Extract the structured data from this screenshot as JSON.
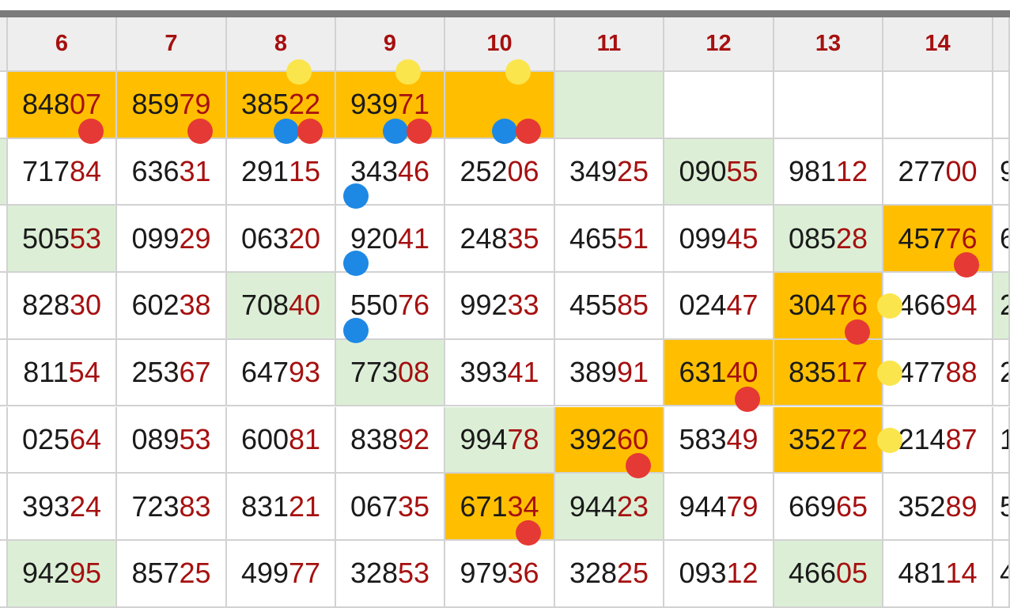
{
  "colors": {
    "header_bg": "#eeeeee",
    "header_text": "#a61010",
    "number_prefix": "#1a1a1a",
    "number_suffix": "#a61010",
    "green": "#dcefd6",
    "orange": "#ffbf00",
    "red_dot": "#e53935",
    "blue_dot": "#1e88e5",
    "yellow_dot": "#fbe54d"
  },
  "headers": [
    "",
    "6",
    "7",
    "8",
    "9",
    "10",
    "11",
    "12",
    "13",
    "14",
    ""
  ],
  "rows": [
    [
      {
        "v": "",
        "bg": "w"
      },
      {
        "v": "84807",
        "bg": "o"
      },
      {
        "v": "85979",
        "bg": "o"
      },
      {
        "v": "38522",
        "bg": "o"
      },
      {
        "v": "93971",
        "bg": "o"
      },
      {
        "v": "",
        "bg": "o"
      },
      {
        "v": "",
        "bg": "g"
      },
      {
        "v": "",
        "bg": "w"
      },
      {
        "v": "",
        "bg": "w"
      },
      {
        "v": "",
        "bg": "w"
      },
      {
        "v": "",
        "bg": "w"
      }
    ],
    [
      {
        "v": "",
        "bg": "g"
      },
      {
        "v": "71784",
        "bg": "w"
      },
      {
        "v": "63631",
        "bg": "w"
      },
      {
        "v": "29115",
        "bg": "w"
      },
      {
        "v": "34346",
        "bg": "w"
      },
      {
        "v": "25206",
        "bg": "w"
      },
      {
        "v": "34925",
        "bg": "w"
      },
      {
        "v": "09055",
        "bg": "g"
      },
      {
        "v": "98112",
        "bg": "w"
      },
      {
        "v": "27700",
        "bg": "w"
      },
      {
        "v": "9",
        "bg": "w"
      }
    ],
    [
      {
        "v": "",
        "bg": "w"
      },
      {
        "v": "50553",
        "bg": "g"
      },
      {
        "v": "09929",
        "bg": "w"
      },
      {
        "v": "06320",
        "bg": "w"
      },
      {
        "v": "92041",
        "bg": "w"
      },
      {
        "v": "24835",
        "bg": "w"
      },
      {
        "v": "46551",
        "bg": "w"
      },
      {
        "v": "09945",
        "bg": "w"
      },
      {
        "v": "08528",
        "bg": "g"
      },
      {
        "v": "45776",
        "bg": "o"
      },
      {
        "v": "6",
        "bg": "w"
      }
    ],
    [
      {
        "v": "",
        "bg": "w"
      },
      {
        "v": "82830",
        "bg": "w"
      },
      {
        "v": "60238",
        "bg": "w"
      },
      {
        "v": "70840",
        "bg": "g"
      },
      {
        "v": "55076",
        "bg": "w"
      },
      {
        "v": "99233",
        "bg": "w"
      },
      {
        "v": "45585",
        "bg": "w"
      },
      {
        "v": "02447",
        "bg": "w"
      },
      {
        "v": "30476",
        "bg": "o"
      },
      {
        "v": "46694",
        "bg": "w"
      },
      {
        "v": "2",
        "bg": "g"
      }
    ],
    [
      {
        "v": "",
        "bg": "w"
      },
      {
        "v": "81154",
        "bg": "w"
      },
      {
        "v": "25367",
        "bg": "w"
      },
      {
        "v": "64793",
        "bg": "w"
      },
      {
        "v": "77308",
        "bg": "g"
      },
      {
        "v": "39341",
        "bg": "w"
      },
      {
        "v": "38991",
        "bg": "w"
      },
      {
        "v": "63140",
        "bg": "o"
      },
      {
        "v": "83517",
        "bg": "o"
      },
      {
        "v": "47788",
        "bg": "w"
      },
      {
        "v": "2",
        "bg": "w"
      }
    ],
    [
      {
        "v": "",
        "bg": "w"
      },
      {
        "v": "02564",
        "bg": "w"
      },
      {
        "v": "08953",
        "bg": "w"
      },
      {
        "v": "60081",
        "bg": "w"
      },
      {
        "v": "83892",
        "bg": "w"
      },
      {
        "v": "99478",
        "bg": "g"
      },
      {
        "v": "39260",
        "bg": "o"
      },
      {
        "v": "58349",
        "bg": "w"
      },
      {
        "v": "35272",
        "bg": "o"
      },
      {
        "v": "21487",
        "bg": "w"
      },
      {
        "v": "1",
        "bg": "w"
      }
    ],
    [
      {
        "v": "",
        "bg": "w"
      },
      {
        "v": "39324",
        "bg": "w"
      },
      {
        "v": "72383",
        "bg": "w"
      },
      {
        "v": "83121",
        "bg": "w"
      },
      {
        "v": "06735",
        "bg": "w"
      },
      {
        "v": "67134",
        "bg": "o"
      },
      {
        "v": "94423",
        "bg": "g"
      },
      {
        "v": "94479",
        "bg": "w"
      },
      {
        "v": "66965",
        "bg": "w"
      },
      {
        "v": "35289",
        "bg": "w"
      },
      {
        "v": "5",
        "bg": "w"
      }
    ],
    [
      {
        "v": "",
        "bg": "w"
      },
      {
        "v": "94295",
        "bg": "g"
      },
      {
        "v": "85725",
        "bg": "w"
      },
      {
        "v": "49977",
        "bg": "w"
      },
      {
        "v": "32853",
        "bg": "w"
      },
      {
        "v": "97936",
        "bg": "w"
      },
      {
        "v": "32825",
        "bg": "w"
      },
      {
        "v": "09312",
        "bg": "w"
      },
      {
        "v": "46605",
        "bg": "g"
      },
      {
        "v": "48114",
        "bg": "w"
      },
      {
        "v": "4",
        "bg": "w"
      }
    ]
  ],
  "markers": [
    {
      "color": "yellow",
      "row": 0,
      "col": 3,
      "pos": "top"
    },
    {
      "color": "yellow",
      "row": 0,
      "col": 4,
      "pos": "top"
    },
    {
      "color": "yellow",
      "row": 0,
      "col": 5,
      "pos": "top"
    },
    {
      "color": "red",
      "row": 0,
      "col": 1,
      "pos": "bottom-right"
    },
    {
      "color": "red",
      "row": 0,
      "col": 2,
      "pos": "bottom-right"
    },
    {
      "color": "blue",
      "row": 0,
      "col": 3,
      "pos": "bottom-mid"
    },
    {
      "color": "red",
      "row": 0,
      "col": 3,
      "pos": "bottom-right"
    },
    {
      "color": "blue",
      "row": 0,
      "col": 4,
      "pos": "bottom-mid"
    },
    {
      "color": "red",
      "row": 0,
      "col": 4,
      "pos": "bottom-right"
    },
    {
      "color": "blue",
      "row": 0,
      "col": 5,
      "pos": "bottom-mid"
    },
    {
      "color": "red",
      "row": 0,
      "col": 5,
      "pos": "bottom-right"
    },
    {
      "color": "blue",
      "row": 1,
      "col": 4,
      "pos": "bottom-left"
    },
    {
      "color": "blue",
      "row": 2,
      "col": 4,
      "pos": "bottom-left"
    },
    {
      "color": "blue",
      "row": 3,
      "col": 4,
      "pos": "bottom-left"
    },
    {
      "color": "red",
      "row": 2,
      "col": 9,
      "pos": "bottom-right"
    },
    {
      "color": "red",
      "row": 3,
      "col": 8,
      "pos": "bottom-right"
    },
    {
      "color": "yellow",
      "row": 3,
      "col": 8,
      "pos": "right"
    },
    {
      "color": "red",
      "row": 4,
      "col": 7,
      "pos": "bottom-right"
    },
    {
      "color": "yellow",
      "row": 4,
      "col": 8,
      "pos": "right"
    },
    {
      "color": "red",
      "row": 5,
      "col": 6,
      "pos": "bottom-right"
    },
    {
      "color": "yellow",
      "row": 5,
      "col": 8,
      "pos": "right"
    },
    {
      "color": "red",
      "row": 6,
      "col": 5,
      "pos": "bottom-right"
    }
  ]
}
